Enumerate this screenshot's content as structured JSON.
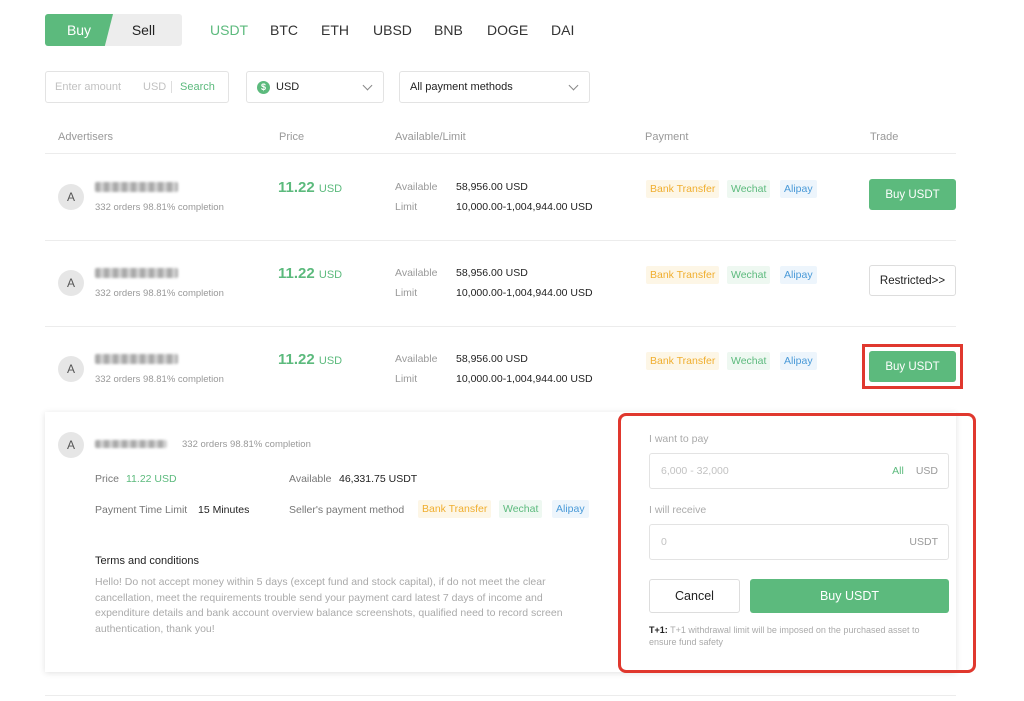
{
  "tabs": {
    "buy": "Buy",
    "sell": "Sell"
  },
  "coins": [
    "USDT",
    "BTC",
    "ETH",
    "UBSD",
    "BNB",
    "DOGE",
    "DAI"
  ],
  "filters": {
    "amount_placeholder": "Enter amount",
    "amount_currency": "USD",
    "search_label": "Search",
    "currency_icon": "$",
    "currency_value": "USD",
    "payment_value": "All payment methods"
  },
  "table": {
    "headers": {
      "advertisers": "Advertisers",
      "price": "Price",
      "available": "Available/Limit",
      "payment": "Payment",
      "trade": "Trade"
    },
    "rows": [
      {
        "avatar": "A",
        "meta": "332 orders  98.81% completion",
        "price": "11.22",
        "price_unit": "USD",
        "available_label": "Available",
        "available": "58,956.00 USD",
        "limit_label": "Limit",
        "limit": "10,000.00-1,004,944.00 USD",
        "pay1": "Bank Transfer",
        "pay2": "Wechat",
        "pay3": "Alipay",
        "action": "Buy USDT"
      },
      {
        "avatar": "A",
        "meta": "332 orders  98.81% completion",
        "price": "11.22",
        "price_unit": "USD",
        "available_label": "Available",
        "available": "58,956.00 USD",
        "limit_label": "Limit",
        "limit": "10,000.00-1,004,944.00 USD",
        "pay1": "Bank Transfer",
        "pay2": "Wechat",
        "pay3": "Alipay",
        "action": "Restricted>>"
      },
      {
        "avatar": "A",
        "meta": "332 orders  98.81% completion",
        "price": "11.22",
        "price_unit": "USD",
        "available_label": "Available",
        "available": "58,956.00 USD",
        "limit_label": "Limit",
        "limit": "10,000.00-1,004,944.00 USD",
        "pay1": "Bank Transfer",
        "pay2": "Wechat",
        "pay3": "Alipay",
        "action": "Buy USDT"
      }
    ]
  },
  "detail": {
    "avatar": "A",
    "meta": "332 orders  98.81% completion",
    "price_label": "Price",
    "price_value": "11.22 USD",
    "available_label": "Available",
    "available_value": "46,331.75 USDT",
    "time_label": "Payment Time Limit",
    "time_value": "15 Minutes",
    "method_label": "Seller's payment method",
    "pay1": "Bank Transfer",
    "pay2": "Wechat",
    "pay3": "Alipay",
    "terms_title": "Terms and conditions",
    "terms_lines": [
      "Hello! Do not accept money within 5 days (except fund and stock capital), if do not meet the clear",
      "cancellation, meet the requirements trouble send your payment card latest 7 days of income and",
      "expenditure details and bank account overview balance screenshots, qualified need to record screen",
      "authentication, thank you!"
    ],
    "pay_label": "I want to pay",
    "pay_placeholder": "6,000 - 32,000",
    "pay_all": "All",
    "pay_currency": "USD",
    "receive_label": "I will receive",
    "receive_placeholder": "0",
    "receive_currency": "USDT",
    "cancel": "Cancel",
    "buy": "Buy USDT",
    "note_bold": "T+1:",
    "note_line1": "T+1 withdrawal limit will be imposed on the purchased asset to",
    "note_line2": "ensure fund safety"
  },
  "colors": {
    "accent": "#5cba7d",
    "highlight": "#e0382e"
  }
}
